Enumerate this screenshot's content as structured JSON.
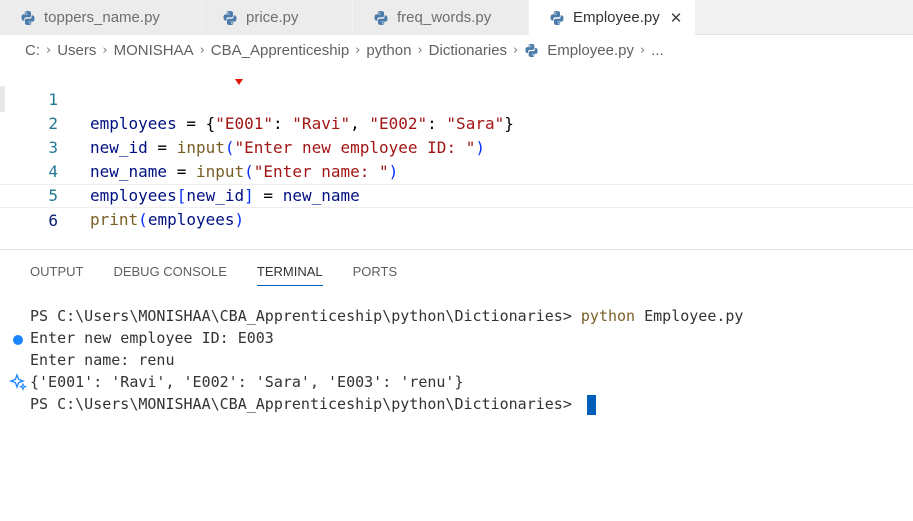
{
  "tabs": [
    {
      "label": "toppers_name.py",
      "icon": "python-file-icon"
    },
    {
      "label": "price.py",
      "icon": "python-file-icon"
    },
    {
      "label": "freq_words.py",
      "icon": "python-file-icon"
    },
    {
      "label": "Employee.py",
      "icon": "python-file-icon",
      "active": true,
      "close": "✕"
    }
  ],
  "breadcrumb": {
    "items": [
      "C:",
      "Users",
      "MONISHAA",
      "CBA_Apprenticeship",
      "python",
      "Dictionaries",
      "Employee.py",
      "..."
    ],
    "separator": "›"
  },
  "editor": {
    "line_numbers": [
      "1",
      "2",
      "3",
      "4",
      "5",
      "6"
    ],
    "lines": [
      [
        [
          "v",
          "employees"
        ],
        [
          "o",
          " = {"
        ],
        [
          "s",
          "\"E001\""
        ],
        [
          "o",
          ": "
        ],
        [
          "s",
          "\"Ravi\""
        ],
        [
          "o",
          ", "
        ],
        [
          "s",
          "\"E002\""
        ],
        [
          "o",
          ": "
        ],
        [
          "s",
          "\"Sara\""
        ],
        [
          "o",
          "}"
        ]
      ],
      [
        [
          "v",
          "new_id"
        ],
        [
          "o",
          " = "
        ],
        [
          "f",
          "input"
        ],
        [
          "p",
          "("
        ],
        [
          "s",
          "\"Enter new employee ID: \""
        ],
        [
          "p",
          ")"
        ]
      ],
      [
        [
          "v",
          "new_name"
        ],
        [
          "o",
          " = "
        ],
        [
          "f",
          "input"
        ],
        [
          "p",
          "("
        ],
        [
          "s",
          "\"Enter name: \""
        ],
        [
          "p",
          ")"
        ]
      ],
      [
        [
          "v",
          "employees"
        ],
        [
          "p",
          "["
        ],
        [
          "v",
          "new_id"
        ],
        [
          "p",
          "]"
        ],
        [
          "o",
          " = "
        ],
        [
          "v",
          "new_name"
        ]
      ],
      [
        [
          "f",
          "print"
        ],
        [
          "p",
          "("
        ],
        [
          "v",
          "employees"
        ],
        [
          "p",
          ")"
        ]
      ],
      []
    ]
  },
  "panel": {
    "tabs": [
      "OUTPUT",
      "DEBUG CONSOLE",
      "TERMINAL",
      "PORTS"
    ],
    "active_tab": "TERMINAL"
  },
  "terminal": {
    "line1_prompt": "PS C:\\Users\\MONISHAA\\CBA_Apprenticeship\\python\\Dictionaries> ",
    "line1_cmd": "python",
    "line1_arg": " Employee.py",
    "line2": "Enter new employee ID: E003",
    "line3": "Enter name: renu",
    "line4": "{'E001': 'Ravi', 'E002': 'Sara', 'E003': 'renu'}",
    "line5_prompt": "PS C:\\Users\\MONISHAA\\CBA_Apprenticeship\\python\\Dictionaries> "
  },
  "colors": {
    "accent": "#005fb8",
    "string": "#a31515",
    "variable": "#001080",
    "function": "#795e26",
    "line_number": "#237893"
  }
}
